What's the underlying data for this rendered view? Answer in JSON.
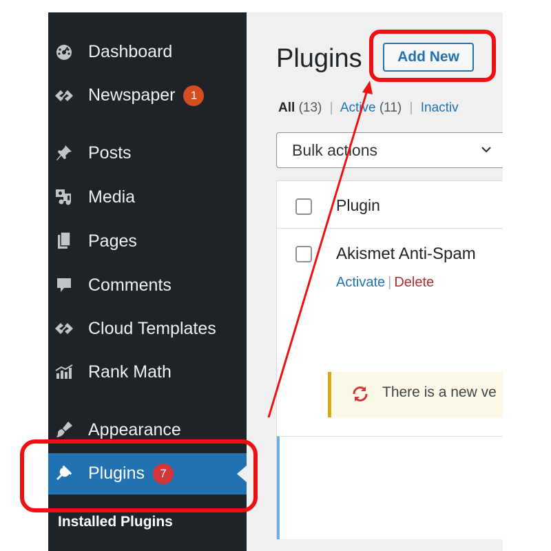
{
  "sidebar": {
    "items": [
      {
        "label": "Dashboard",
        "icon": "dashboard-icon"
      },
      {
        "label": "Newspaper",
        "icon": "newspaper-icon",
        "badge": "1"
      },
      {
        "label": "Posts",
        "icon": "pin-icon"
      },
      {
        "label": "Media",
        "icon": "media-icon"
      },
      {
        "label": "Pages",
        "icon": "pages-icon"
      },
      {
        "label": "Comments",
        "icon": "comment-icon"
      },
      {
        "label": "Cloud Templates",
        "icon": "cloud-templates-icon"
      },
      {
        "label": "Rank Math",
        "icon": "chart-icon"
      },
      {
        "label": "Appearance",
        "icon": "brush-icon"
      },
      {
        "label": "Plugins",
        "icon": "plugin-icon",
        "badge": "7",
        "current": true
      }
    ],
    "submenu_label": "Installed Plugins"
  },
  "main": {
    "title": "Plugins",
    "add_new_label": "Add New",
    "filters": {
      "all_label": "All",
      "all_count": "(13)",
      "active_label": "Active",
      "active_count": "(11)",
      "inactive_label": "Inactiv",
      "separator": "|"
    },
    "bulk_actions": {
      "selected": "Bulk actions"
    },
    "table": {
      "column_plugin": "Plugin",
      "rows": [
        {
          "name": "Akismet Anti-Spam",
          "activate": "Activate",
          "delete": "Delete"
        }
      ],
      "notice_text": "There is a new ve"
    }
  },
  "colors": {
    "sidebar_bg": "#1d2327",
    "current_bg": "#2271b1",
    "link": "#2271b1",
    "delete": "#b32d2e",
    "badge": "#d63638",
    "notice_border": "#dba617",
    "annotation": "#ee1111"
  }
}
